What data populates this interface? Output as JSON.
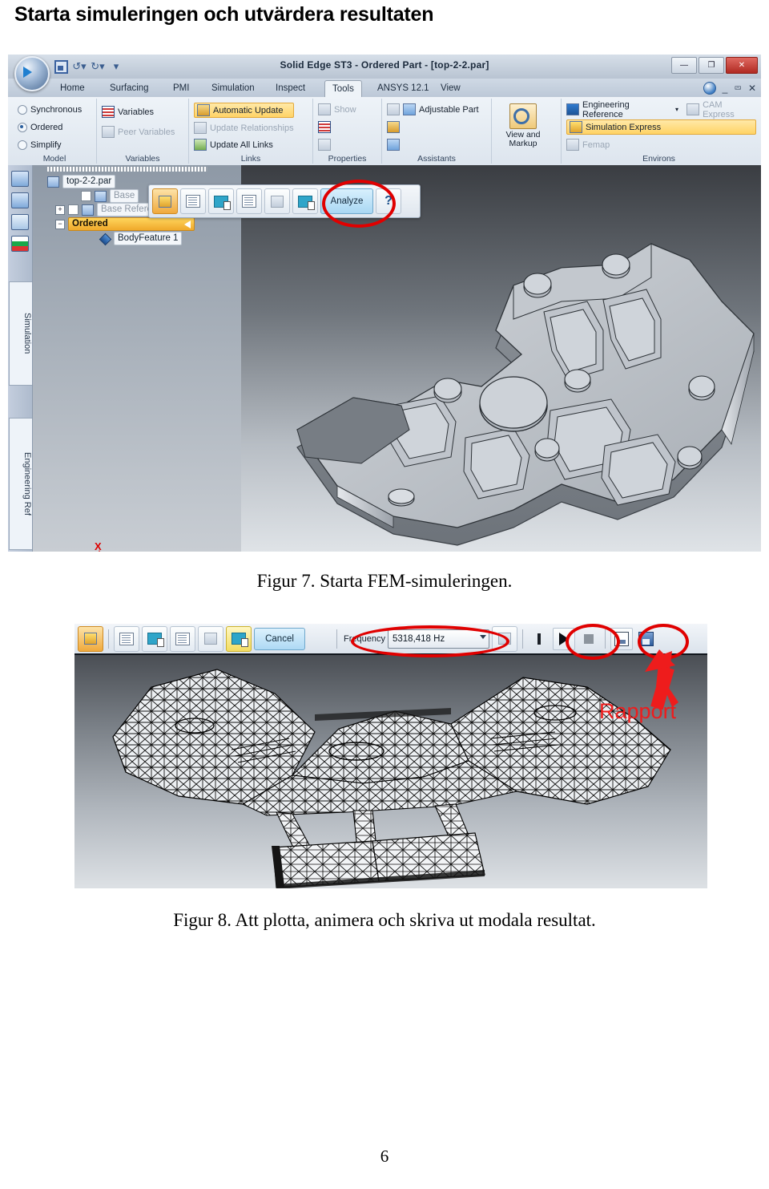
{
  "document": {
    "heading": "Starta simuleringen och utvärdera resultaten",
    "page_number": "6"
  },
  "figure7": {
    "caption": "Figur 7. Starta FEM-simuleringen.",
    "window": {
      "title": "Solid Edge ST3 - Ordered Part - [top-2-2.par]",
      "min_label": "—",
      "max_label": "❐",
      "close_label": "✕",
      "ribbon_min_label": "_",
      "ribbon_restore_label": "⮹",
      "ribbon_close_label": "✕"
    },
    "tabs": [
      {
        "label": "Home",
        "active": false
      },
      {
        "label": "Surfacing",
        "active": false
      },
      {
        "label": "PMI",
        "active": false
      },
      {
        "label": "Simulation",
        "active": false
      },
      {
        "label": "Inspect",
        "active": false
      },
      {
        "label": "Tools",
        "active": true
      },
      {
        "label": "ANSYS 12.1",
        "active": false
      },
      {
        "label": "View",
        "active": false
      }
    ],
    "ribbon_groups": [
      {
        "name": "Model",
        "label": "Model",
        "items": [
          {
            "label": "Synchronous",
            "state": "off"
          },
          {
            "label": "Ordered",
            "state": "on"
          },
          {
            "label": "Simplify",
            "state": "off"
          }
        ]
      },
      {
        "name": "Variables",
        "label": "Variables",
        "items": [
          {
            "label": "Variables",
            "state": "enabled"
          },
          {
            "label": "Peer Variables",
            "state": "disabled"
          }
        ]
      },
      {
        "name": "Links",
        "label": "Links",
        "items": [
          {
            "label": "Automatic Update",
            "state": "highlighted"
          },
          {
            "label": "Update Relationships",
            "state": "disabled"
          },
          {
            "label": "Update All Links",
            "state": "enabled"
          }
        ]
      },
      {
        "name": "Properties",
        "label": "Properties",
        "items": [
          {
            "label": "Show",
            "state": "disabled"
          }
        ]
      },
      {
        "name": "Assistants",
        "label": "Assistants",
        "items": [
          {
            "label": "Adjustable Part",
            "state": "enabled"
          }
        ]
      },
      {
        "name": "ViewAndMarkup",
        "label": "",
        "items": [
          {
            "label": "View and\nMarkup",
            "state": "enabled"
          }
        ]
      },
      {
        "name": "Environs",
        "label": "Environs",
        "items": [
          {
            "label": "Engineering Reference",
            "state": "enabled"
          },
          {
            "label": "CAM Express",
            "state": "disabled"
          },
          {
            "label": "Simulation Express",
            "state": "highlighted"
          },
          {
            "label": "Femap",
            "state": "disabled"
          }
        ]
      }
    ],
    "command_bar": {
      "analyze_label": "Analyze",
      "help_label": "?"
    },
    "left_rail_tabs": [
      "Simulation",
      "Engineering Ref"
    ],
    "tree": {
      "root": "top-2-2.par",
      "nodes": [
        {
          "label": "Base",
          "state": "dim",
          "indent": 1
        },
        {
          "label": "Base Reference Planes",
          "state": "dim",
          "indent": 1,
          "expander": "+"
        },
        {
          "label": "Ordered",
          "state": "selected",
          "indent": 1,
          "expander": "−"
        },
        {
          "label": "BodyFeature 1",
          "state": "normal",
          "indent": 2
        }
      ]
    },
    "annotation": {
      "type": "red-ellipse",
      "target": "Analyze"
    }
  },
  "figure8": {
    "caption": "Figur 8. Att plotta, animera och skriva ut modala resultat.",
    "toolbar": {
      "cancel_label": "Cancel",
      "frequency_label": "Frequency",
      "frequency_value": "5318,418 Hz"
    },
    "annotations": {
      "rapport_label": "Rapport",
      "ellipse_targets": [
        "frequency-combo",
        "play-button",
        "report-button"
      ],
      "arrow_color": "#ee1c1c"
    }
  }
}
